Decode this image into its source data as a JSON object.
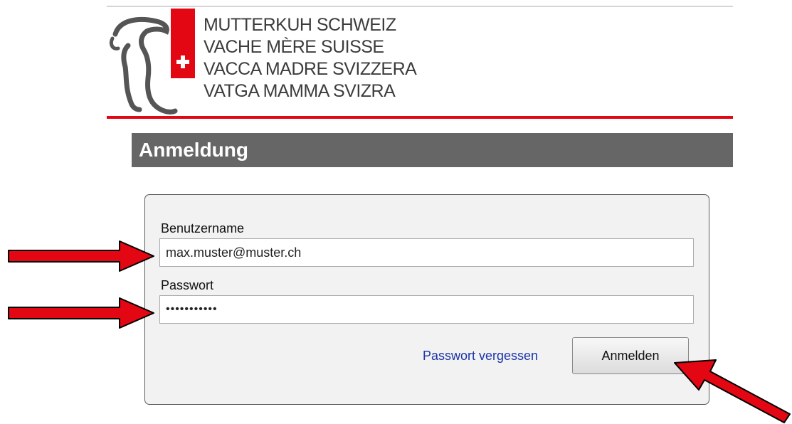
{
  "header": {
    "org_names": [
      "MUTTERKUH SCHWEIZ",
      "VACHE MÈRE SUISSE",
      "VACCA MADRE SVIZZERA",
      "VATGA MAMMA SVIZRA"
    ],
    "brand_colors": {
      "red": "#e30613",
      "title_bar": "#666666"
    }
  },
  "page": {
    "title": "Anmeldung"
  },
  "login": {
    "username_label": "Benutzername",
    "username_value": "max.muster@muster.ch",
    "password_label": "Passwort",
    "password_value": "•••••••••••",
    "forgot_link": "Passwort vergessen",
    "submit_label": "Anmelden"
  },
  "annotations": {
    "arrow_color": "#e30613",
    "arrow_count": 3
  }
}
